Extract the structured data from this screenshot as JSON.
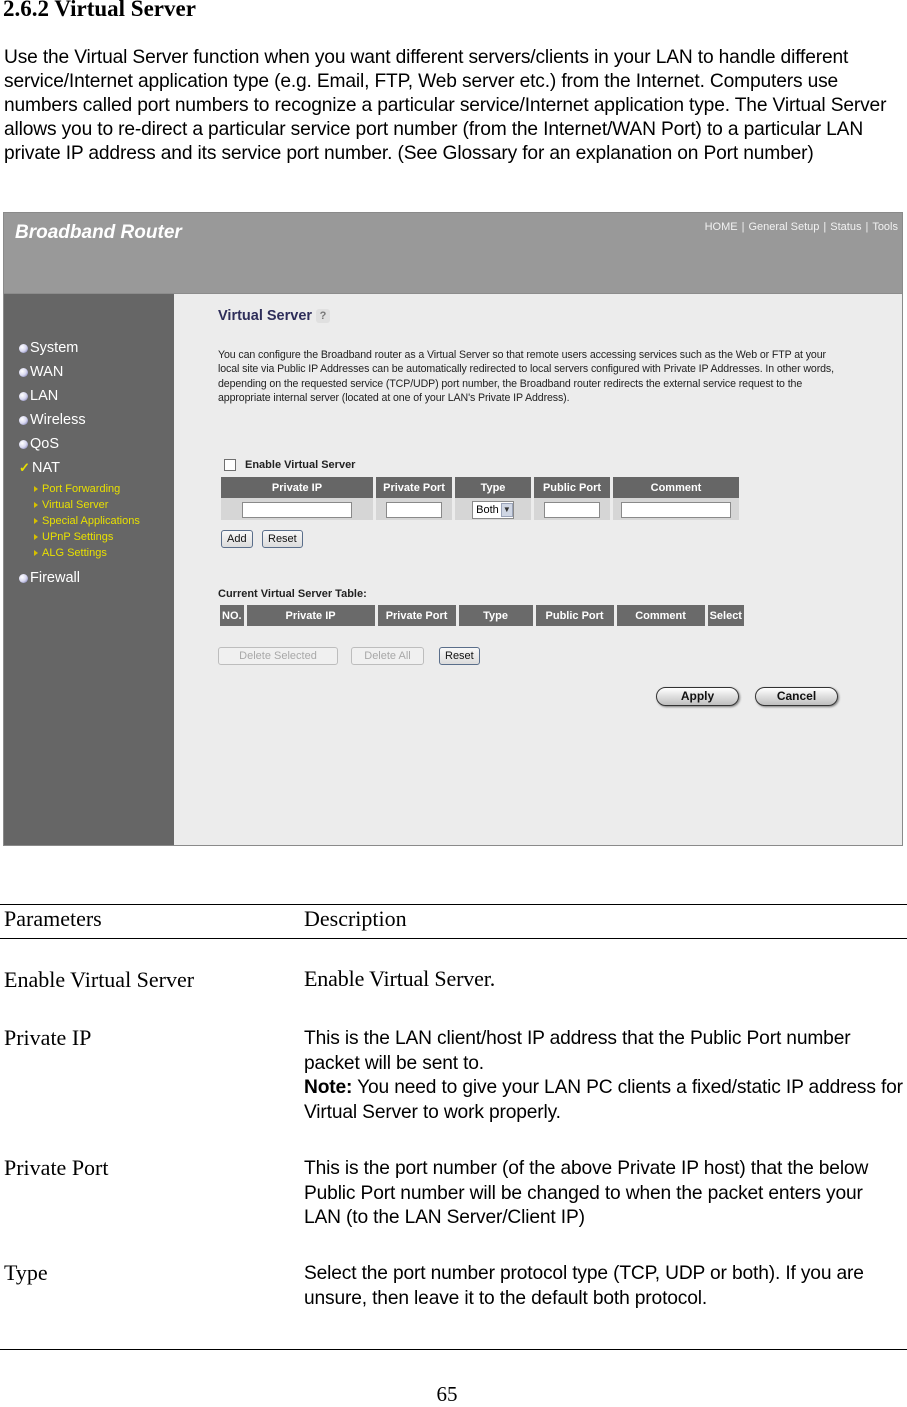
{
  "document": {
    "heading": "2.6.2 Virtual Server",
    "intro": "Use the Virtual Server function when you want different servers/clients in your LAN to handle different service/Internet application type (e.g. Email, FTP, Web server etc.) from the Internet. Computers use numbers called port numbers to recognize a particular service/Internet application type. The Virtual Server allows you to re-direct a particular service port number (from the Internet/WAN Port) to a particular LAN private IP address and its service port number. (See Glossary for an explanation on Port number)",
    "page_number": "65"
  },
  "router": {
    "logo": "Broadband Router",
    "topnav": [
      "HOME",
      "General Setup",
      "Status",
      "Tools"
    ],
    "sidebar": {
      "items": [
        {
          "label": "System",
          "icon": "bullet"
        },
        {
          "label": "WAN",
          "icon": "bullet"
        },
        {
          "label": "LAN",
          "icon": "bullet"
        },
        {
          "label": "Wireless",
          "icon": "bullet"
        },
        {
          "label": "QoS",
          "icon": "bullet"
        },
        {
          "label": "NAT",
          "icon": "check"
        },
        {
          "label": "Firewall",
          "icon": "bullet"
        }
      ],
      "nat_subitems": [
        "Port Forwarding",
        "Virtual Server",
        "Special Applications",
        "UPnP Settings",
        "ALG Settings"
      ]
    },
    "main": {
      "title": "Virtual Server",
      "help_icon": "?",
      "description": "You can configure the Broadband router as a Virtual Server so that remote users accessing services such as the Web or FTP at your local site via Public IP Addresses can be automatically redirected to local servers configured with Private IP Addresses. In other words, depending on the requested service (TCP/UDP) port number, the Broadband router redirects the external service request to the appropriate internal server (located at one of your LAN's Private IP Address).",
      "enable_label": "Enable Virtual Server",
      "enable_checked": false,
      "entry_headers": [
        "Private IP",
        "Private Port",
        "Type",
        "Public Port",
        "Comment"
      ],
      "entry_values": {
        "private_ip": "",
        "private_port": "",
        "type": "Both",
        "public_port": "",
        "comment": ""
      },
      "add_label": "Add",
      "reset_label": "Reset",
      "current_table_label": "Current Virtual Server Table:",
      "current_headers": [
        "NO.",
        "Private IP",
        "Private Port",
        "Type",
        "Public Port",
        "Comment",
        "Select"
      ],
      "delete_selected_label": "Delete Selected",
      "delete_all_label": "Delete All",
      "reset2_label": "Reset",
      "apply_label": "Apply",
      "cancel_label": "Cancel"
    }
  },
  "parameters": {
    "header_param": "Parameters",
    "header_desc": "Description",
    "rows": [
      {
        "name": "Enable Virtual Server",
        "desc": "Enable Virtual Server."
      },
      {
        "name": "Private IP",
        "desc": "This is the LAN client/host IP address that the Public Port number packet will be sent to.",
        "note_label": "Note:",
        "note": " You need to give your LAN PC clients a fixed/static IP address for Virtual Server to work properly."
      },
      {
        "name": "Private Port",
        "desc": "This is the port number (of the above Private IP host) that the below Public Port number will be changed to when the packet enters your LAN (to the LAN Server/Client IP)"
      },
      {
        "name": "Type",
        "desc": "Select the port number protocol type (TCP, UDP or both). If you are unsure, then leave it to the default both protocol."
      }
    ]
  }
}
